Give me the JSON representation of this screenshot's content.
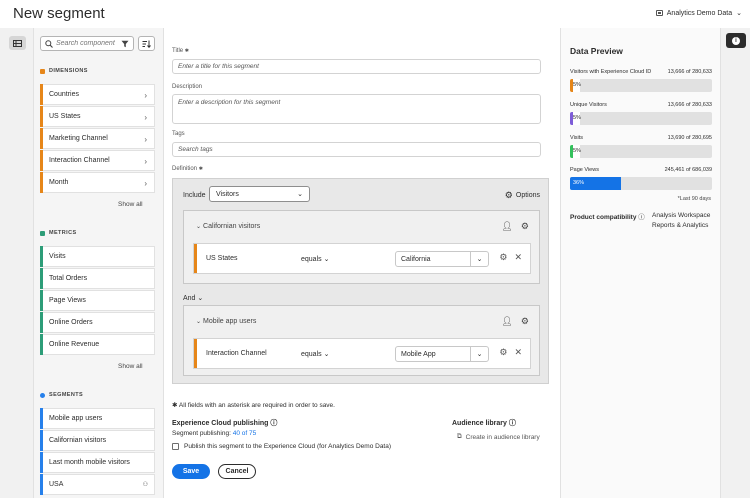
{
  "header": {
    "title": "New segment",
    "report_suite": "Analytics Demo Data"
  },
  "search": {
    "placeholder": "Search component"
  },
  "dimensions": {
    "heading": "DIMENSIONS",
    "items": [
      "Countries",
      "US States",
      "Marketing Channel",
      "Interaction Channel",
      "Month"
    ],
    "show_all": "Show all"
  },
  "metrics": {
    "heading": "METRICS",
    "items": [
      "Visits",
      "Total Orders",
      "Page Views",
      "Online Orders",
      "Online Revenue"
    ],
    "show_all": "Show all"
  },
  "segments": {
    "heading": "SEGMENTS",
    "items": [
      "Mobile app users",
      "Californian visitors",
      "Last month mobile visitors",
      "USA"
    ]
  },
  "builder": {
    "title_label": "Title",
    "title_placeholder": "Enter a title for this segment",
    "desc_label": "Description",
    "desc_placeholder": "Enter a description for this segment",
    "tags_label": "Tags",
    "tags_placeholder": "Search tags",
    "definition_label": "Definition",
    "include_label": "Include",
    "include_value": "Visitors",
    "options_label": "Options",
    "container1": {
      "title": "Californian visitors",
      "rule": {
        "dimension": "US States",
        "operator": "equals",
        "value": "California"
      }
    },
    "and_label": "And",
    "container2": {
      "title": "Mobile app users",
      "rule": {
        "dimension": "Interaction Channel",
        "operator": "equals",
        "value": "Mobile App"
      }
    },
    "required_note": "All fields with an asterisk are required in order to save.",
    "publishing_title": "Experience Cloud publishing",
    "publishing_prefix": "Segment publishing:",
    "publishing_count": "40 of 75",
    "publish_checkbox": "Publish this segment to the Experience Cloud (for Analytics Demo Data)",
    "audience_title": "Audience library",
    "audience_create": "Create in audience library",
    "save": "Save",
    "cancel": "Cancel"
  },
  "preview": {
    "title": "Data Preview",
    "metrics": [
      {
        "label": "Visitors with Experience Cloud ID",
        "value": "13,666 of 280,633",
        "pct": "5%",
        "fraction": 0.05,
        "color": "#e68619"
      },
      {
        "label": "Unique Visitors",
        "value": "13,666 of 280,633",
        "pct": "5%",
        "fraction": 0.05,
        "color": "#7e5dd8"
      },
      {
        "label": "Visits",
        "value": "13,690 of 280,695",
        "pct": "5%",
        "fraction": 0.05,
        "color": "#33c15c"
      },
      {
        "label": "Page Views",
        "value": "245,461 of 686,039",
        "pct": "36%",
        "fraction": 0.36,
        "color": "#1473e6"
      }
    ],
    "last_days": "*Last 90 days",
    "compat_label": "Product compatibility",
    "compat_line1": "Analysis Workspace",
    "compat_line2": "Reports & Analytics"
  },
  "colors": {
    "dimension": "#e68619",
    "metric": "#2d9d78",
    "segment": "#2680eb",
    "accent": "#1473e6"
  }
}
